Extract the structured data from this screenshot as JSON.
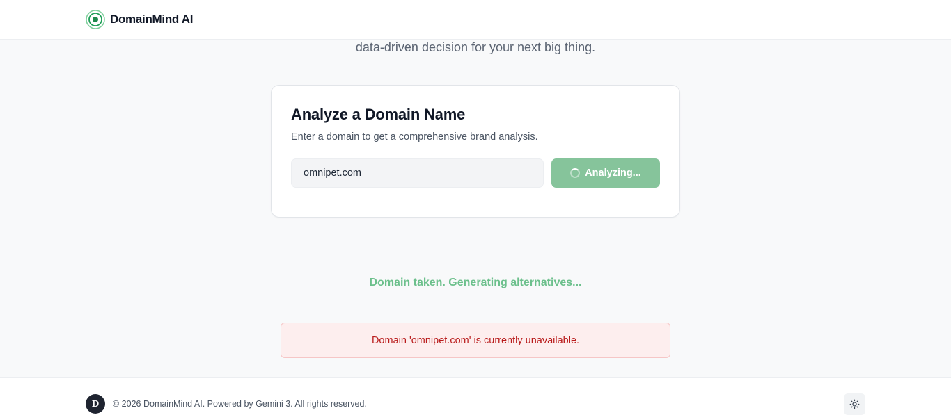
{
  "header": {
    "brand_name": "DomainMind AI",
    "logo_icon": "radar-target-icon",
    "accent_color": "#22a05a"
  },
  "hero": {
    "subtitle": "data-driven decision for your next big thing."
  },
  "analyzer": {
    "title": "Analyze a Domain Name",
    "description": "Enter a domain to get a comprehensive brand analysis.",
    "input_value": "omnipet.com",
    "button_label": "Analyzing...",
    "button_icon": "spinner-icon",
    "button_color": "#86c49b"
  },
  "status": {
    "message": "Domain taken. Generating alternatives...",
    "color": "#6cc08c"
  },
  "error": {
    "message": "Domain 'omnipet.com' is currently unavailable.",
    "color": "#b91c1c"
  },
  "footer": {
    "avatar_letter": "D",
    "copyright": "© 2026 DomainMind AI. Powered by Gemini 3. All rights reserved.",
    "theme_toggle_icon": "sun-icon"
  }
}
